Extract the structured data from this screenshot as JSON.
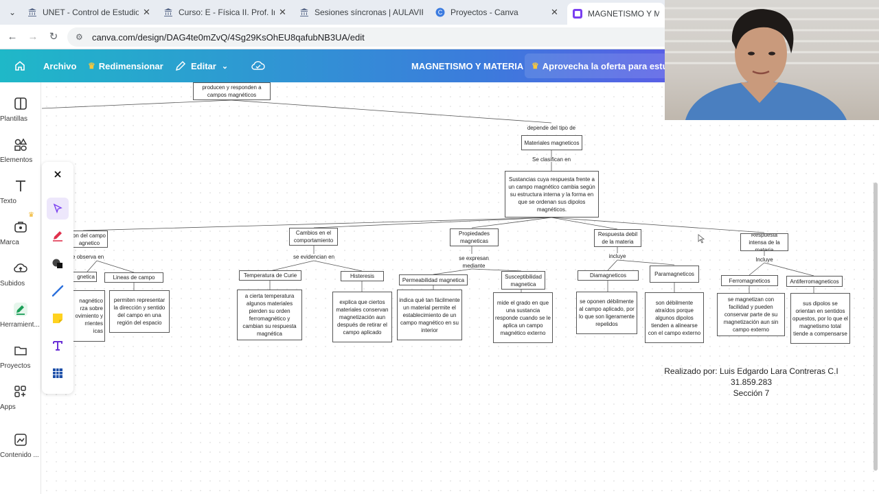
{
  "browser": {
    "tabs": [
      {
        "title": "UNET - Control de Estudios y Ev",
        "active": false
      },
      {
        "title": "Curso: E - Física II. Prof. Irenia M",
        "active": false
      },
      {
        "title": "Sesiones síncronas | AULAVIRTU",
        "active": false
      },
      {
        "title": "Proyectos - Canva",
        "active": false
      },
      {
        "title": "MAGNETISMO Y MATERIA",
        "active": true
      }
    ],
    "url": "canva.com/design/DAG4te0mZvQ/4Sg29KsOhEU8qafubNB3UA/edit"
  },
  "canva_header": {
    "home_icon": "home-icon",
    "archivo": "Archivo",
    "redimensionar": "Redimensionar",
    "editar": "Editar",
    "document_title": "MAGNETISMO Y MATERIA",
    "offer": "Aprovecha la oferta para estud",
    "colors": {
      "gradient_start": "#1fb8c8",
      "gradient_end": "#7a3ff0",
      "crown": "#f8c83c"
    }
  },
  "sidebar": {
    "items": [
      {
        "label": "Plantillas",
        "icon": "templates-icon"
      },
      {
        "label": "Elementos",
        "icon": "elements-icon"
      },
      {
        "label": "Texto",
        "icon": "text-icon"
      },
      {
        "label": "Marca",
        "icon": "brand-icon"
      },
      {
        "label": "Subidos",
        "icon": "uploads-icon"
      },
      {
        "label": "Herramient...",
        "icon": "tools-icon"
      },
      {
        "label": "Proyectos",
        "icon": "folder-icon"
      },
      {
        "label": "Apps",
        "icon": "apps-icon"
      },
      {
        "label": "Contenido ...",
        "icon": "content-icon"
      }
    ]
  },
  "draw_tools": [
    "close-icon",
    "select-arrow-icon",
    "pen-icon",
    "shape-icon",
    "line-icon",
    "sticky-note-icon",
    "text-tool-icon",
    "table-icon"
  ],
  "concept_map": {
    "top_node": "producen y responden a campos magnéticos",
    "depends_label": "depende del  tipo de",
    "materials_node": "Materiales magneticos",
    "classified_label": "Se clasifican en",
    "substances_node": "Sustancias cuya respuesta frente a un campo magnético cambia según su estructura interna y la forma en que se ordenan sus dipolos magnéticos.",
    "left_partial": {
      "node": "on del campo\nagnetico",
      "label": "se observa en",
      "child1": "gnetica",
      "child1_desc": "nagnético\nrza sobre\novimiento y\nrrientes\nicas",
      "child2": "Lineas de campo",
      "child2_desc": "permiten representar la dirección y sentido del campo en una región del espacio"
    },
    "branch_cambios": {
      "node": "Cambios en el comportamiento",
      "label": "se evidencian en",
      "child1": "Temperatura de Curie",
      "child1_desc": "a cierta temperatura algunos materiales pierden su orden ferromagnético y cambian su respuesta magnética",
      "child2": "Histeresis",
      "child2_desc": "explica que ciertos materiales conservan magnetización aun después de retirar el campo aplicado"
    },
    "branch_propiedades": {
      "node": "Propiedades magneticas",
      "label": "se expresan mediante",
      "child1": "Permeabilidad magnetica",
      "child1_desc": "indica qué tan fácilmente un material permite el establecimiento de un campo magnético en su interior",
      "child2": "Susceptibilidad magnetica",
      "child2_desc": "mide el grado en que una sustancia responde cuando se le aplica un campo magnético externo"
    },
    "branch_debil": {
      "node": "Respuesta debil de la materia",
      "label": "incluye",
      "child1": "Diamagneticos",
      "child1_desc": "se oponen débilmente al campo aplicado, por lo que son ligeramente repelidos",
      "child2": "Paramagneticos",
      "child2_desc": "son débilmente atraídos porque algunos dipolos tienden a alinearse con el campo externo"
    },
    "branch_intensa": {
      "node": "Respuesta intensa de la materia",
      "label": "Incluye",
      "child1": "Ferromagneticos",
      "child1_desc": "se magnetizan con facilidad y pueden conservar parte de su magnetización aun sin campo externo",
      "child2": "Antiferromagneticos",
      "child2_desc": "sus dipolos se orientan en sentidos opuestos, por lo que el magnetismo total tiende a compensarse"
    },
    "credit_line1": "Realizado por: Luis Edgardo Lara Contreras C.I 31.859.283",
    "credit_line2": "Sección 7"
  }
}
